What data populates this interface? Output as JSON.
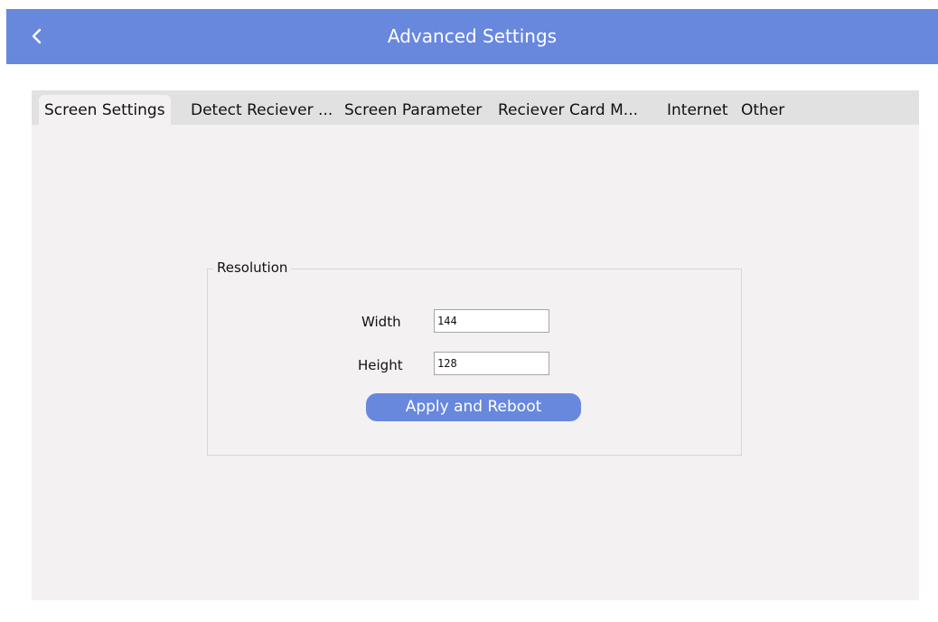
{
  "header": {
    "title": "Advanced Settings",
    "back_icon": "chevron-left-icon"
  },
  "tabs": [
    {
      "label": "Screen Settings",
      "active": true
    },
    {
      "label": "Detect Reciever ..."
    },
    {
      "label": "Screen Parameter"
    },
    {
      "label": "Reciever Card M..."
    },
    {
      "label": "Internet"
    },
    {
      "label": "Other"
    }
  ],
  "resolution": {
    "group_title": "Resolution",
    "width_label": "Width",
    "width_value": "144",
    "height_label": "Height",
    "height_value": "128",
    "apply_label": "Apply and Reboot"
  },
  "colors": {
    "accent": "#6888de",
    "panel_bg": "#f3f1f2",
    "tabbar_bg": "#e1e1e1"
  }
}
